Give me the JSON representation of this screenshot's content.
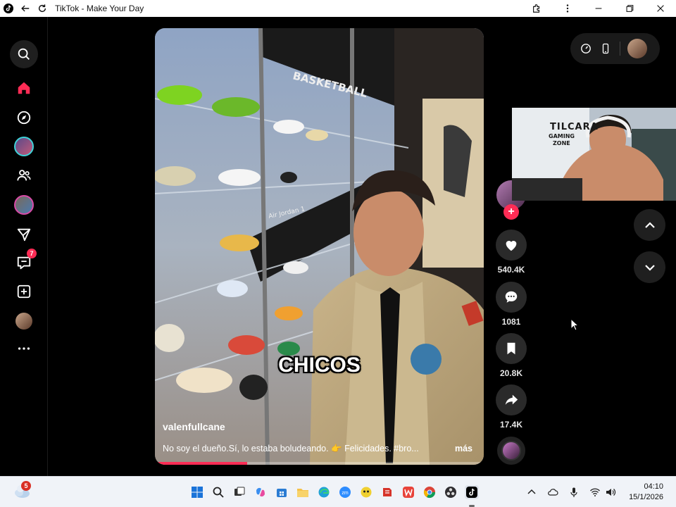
{
  "window": {
    "title": "TikTok - Make Your Day"
  },
  "nav": {
    "messages_badge": "7"
  },
  "video": {
    "overlay_caption": "CHICOS",
    "username": "valenfullcane",
    "description": "No soy el dueño.Sí, lo estaba boludeando. 👉 Felicidades. #bro...",
    "more_label": "más",
    "progress": 0.28,
    "scene_labels": {
      "wall_sign_1": "BASKETBALL",
      "wall_sign_2": "Air Jordan 1"
    }
  },
  "actions": {
    "likes": "540.4K",
    "comments": "1081",
    "saves": "20.8K",
    "shares": "17.4K"
  },
  "webcam": {
    "sign_line1": "TILCARA",
    "sign_line2": "GAMING",
    "sign_line3": "ZONE"
  },
  "taskbar": {
    "weather_badge": "5",
    "time": "04:10",
    "date": "15/1/2026"
  },
  "colors": {
    "accent": "#fe2c55",
    "background": "#000000",
    "taskbar": "#f0f3f8"
  }
}
